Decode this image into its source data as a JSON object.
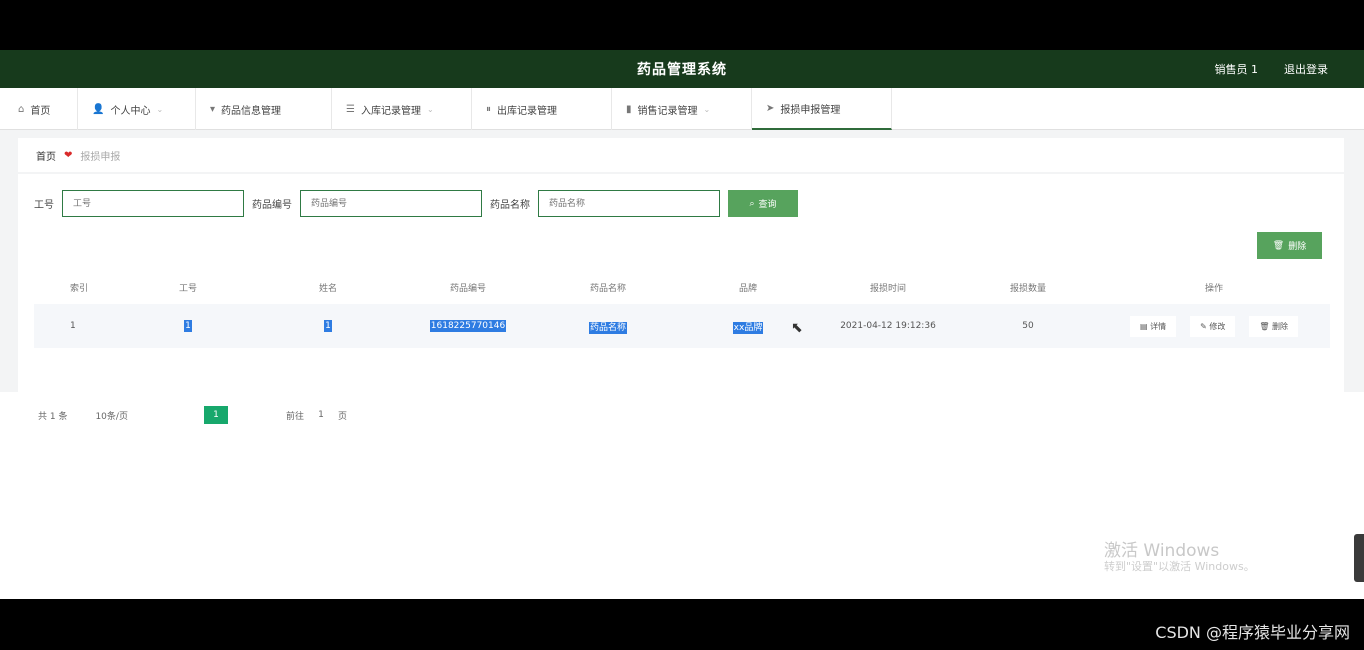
{
  "header": {
    "title": "药品管理系统",
    "user": "销售员 1",
    "logout": "退出登录"
  },
  "nav": [
    {
      "label": "首页",
      "icon": "home-icon",
      "has_dropdown": false
    },
    {
      "label": "个人中心",
      "icon": "user-icon",
      "has_dropdown": true
    },
    {
      "label": "药品信息管理",
      "icon": "pill-icon",
      "has_dropdown": false
    },
    {
      "label": "入库记录管理",
      "icon": "list-icon",
      "has_dropdown": true
    },
    {
      "label": "出库记录管理",
      "icon": "columns-icon",
      "has_dropdown": false
    },
    {
      "label": "销售记录管理",
      "icon": "chart-icon",
      "has_dropdown": true
    },
    {
      "label": "报损申报管理",
      "icon": "flag-icon",
      "has_dropdown": false,
      "active": true
    }
  ],
  "breadcrumb": {
    "home": "首页",
    "current": "报损申报"
  },
  "search": {
    "field1_label": "工号",
    "field1_placeholder": "工号",
    "field2_label": "药品编号",
    "field2_placeholder": "药品编号",
    "field3_label": "药品名称",
    "field3_placeholder": "药品名称",
    "query_button": "查询"
  },
  "actions": {
    "delete_button": "删除"
  },
  "table": {
    "headers": [
      "索引",
      "工号",
      "姓名",
      "药品编号",
      "药品名称",
      "品牌",
      "报损时间",
      "报损数量",
      "操作"
    ],
    "rows": [
      {
        "index": "1",
        "employee_id": "1",
        "name": "1",
        "drug_no": "1618225770146",
        "drug_name": "药品名称",
        "brand": "xx品牌",
        "time": "2021-04-12 19:12:36",
        "quantity": "50",
        "op_detail": "详情",
        "op_edit": "修改",
        "op_delete": "删除"
      }
    ]
  },
  "pagination": {
    "total": "共 1 条",
    "page_size": "10条/页",
    "current_page": "1",
    "goto_label": "前往",
    "goto_value": "1",
    "page_suffix": "页"
  },
  "watermark": {
    "line1": "激活 Windows",
    "line2": "转到\"设置\"以激活 Windows。"
  },
  "footer_credit": "CSDN @程序猿毕业分享网",
  "colors": {
    "topbar": "#173a1c",
    "accent_green": "#57a35d",
    "page_active": "#17a86c",
    "selection": "#2e7ce2"
  }
}
